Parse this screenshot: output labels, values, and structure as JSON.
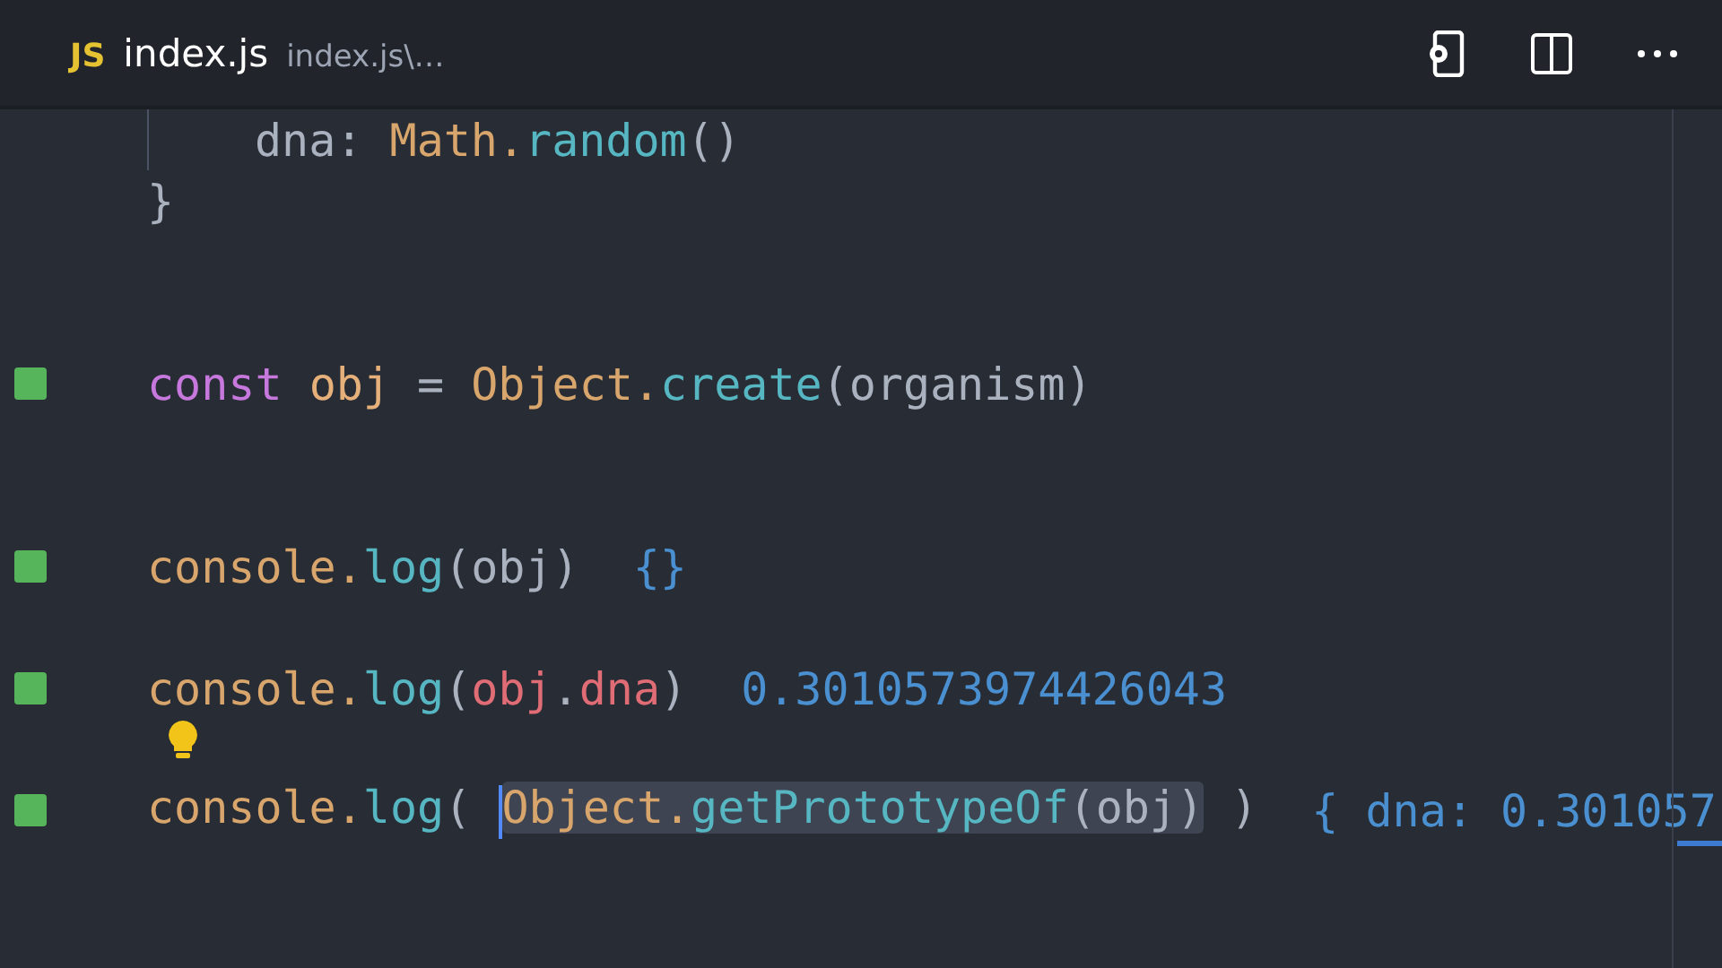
{
  "tab": {
    "badge": "JS",
    "title": "index.js",
    "path": "index.js\\…"
  },
  "lines": [
    {
      "kind": "code",
      "indented": true,
      "marker": false,
      "tokens": [
        {
          "text": "dna: ",
          "kind": "plain"
        },
        {
          "text": "Math.",
          "kind": "class"
        },
        {
          "text": "random",
          "kind": "function"
        },
        {
          "text": "()",
          "kind": "plain"
        }
      ]
    },
    {
      "kind": "code",
      "indented": false,
      "marker": false,
      "tokens": [
        {
          "text": "}",
          "kind": "plain"
        }
      ]
    },
    {
      "kind": "blank"
    },
    {
      "kind": "blank"
    },
    {
      "kind": "code",
      "indented": false,
      "marker": true,
      "tokens": [
        {
          "text": "const ",
          "kind": "keyword"
        },
        {
          "text": "obj",
          "kind": "variable"
        },
        {
          "text": " = ",
          "kind": "plain"
        },
        {
          "text": "Object.",
          "kind": "class"
        },
        {
          "text": "create",
          "kind": "function"
        },
        {
          "text": "(organism)",
          "kind": "plain"
        }
      ]
    },
    {
      "kind": "blank"
    },
    {
      "kind": "blank"
    },
    {
      "kind": "code",
      "indented": false,
      "marker": true,
      "tokens": [
        {
          "text": "console.",
          "kind": "class"
        },
        {
          "text": "log",
          "kind": "function"
        },
        {
          "text": "(obj)",
          "kind": "plain"
        }
      ],
      "result": "{}"
    },
    {
      "kind": "blank"
    },
    {
      "kind": "code",
      "indented": false,
      "marker": true,
      "tokens": [
        {
          "text": "console.",
          "kind": "class"
        },
        {
          "text": "log",
          "kind": "function"
        },
        {
          "text": "(",
          "kind": "plain"
        },
        {
          "text": "obj",
          "kind": "property"
        },
        {
          "text": ".",
          "kind": "plain"
        },
        {
          "text": "dna",
          "kind": "property"
        },
        {
          "text": ")",
          "kind": "plain"
        }
      ],
      "result": "0.3010573974426043"
    },
    {
      "kind": "hint"
    },
    {
      "kind": "code",
      "indented": false,
      "marker": true,
      "tokens": [
        {
          "text": "console.",
          "kind": "class"
        },
        {
          "text": "log",
          "kind": "function"
        },
        {
          "text": "( ",
          "kind": "plain"
        }
      ],
      "selection": [
        {
          "text": "Object.",
          "kind": "class"
        },
        {
          "text": "getPrototypeOf",
          "kind": "function"
        },
        {
          "text": "(obj)",
          "kind": "plain"
        }
      ],
      "after": " )",
      "result": "{ dna: 0.301057"
    }
  ]
}
